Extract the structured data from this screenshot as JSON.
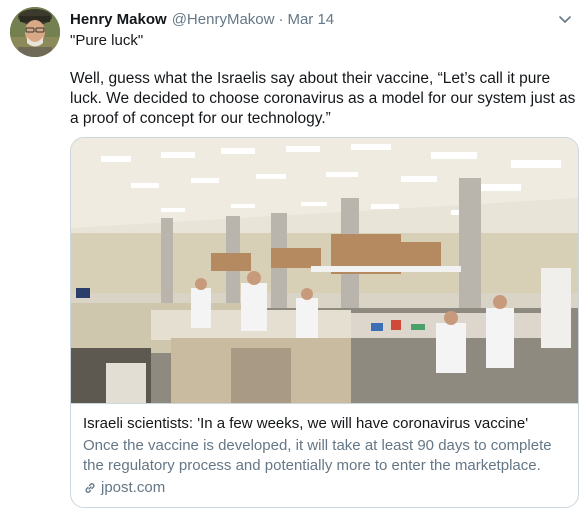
{
  "tweet": {
    "author_name": "Henry Makow",
    "author_handle": "@HenryMakow",
    "separator": "·",
    "date": "Mar 14",
    "text_line1": "\"Pure luck\"",
    "text_body": "Well, guess what the Israelis say about their vaccine, “Let’s call it pure luck. We decided to choose coronavirus as a model for our system just as a proof of concept for our technology.”"
  },
  "card": {
    "title": "Israeli scientists: 'In a few weeks, we will have coronavirus vaccine'",
    "description": "Once the vaccine is developed, it will take at least 90 days to complete the regulatory process and potentially more to enter the marketplace.",
    "domain": "jpost.com"
  },
  "icons": {
    "chevron": "chevron-down-icon",
    "link": "link-icon"
  },
  "colors": {
    "name": "#14171a",
    "secondary": "#657786",
    "border": "#ccd6dd"
  }
}
